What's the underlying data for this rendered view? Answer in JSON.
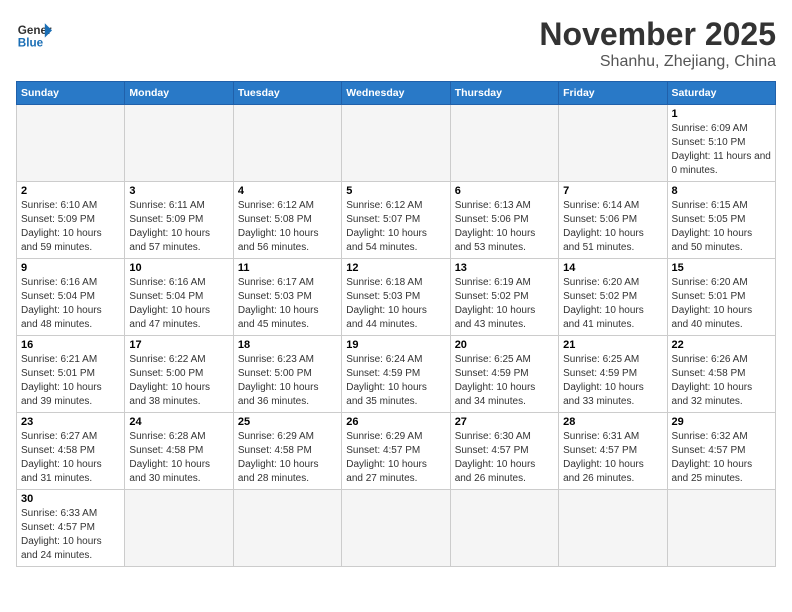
{
  "header": {
    "logo_general": "General",
    "logo_blue": "Blue",
    "title": "November 2025",
    "subtitle": "Shanhu, Zhejiang, China"
  },
  "weekdays": [
    "Sunday",
    "Monday",
    "Tuesday",
    "Wednesday",
    "Thursday",
    "Friday",
    "Saturday"
  ],
  "weeks": [
    [
      {
        "day": "",
        "info": ""
      },
      {
        "day": "",
        "info": ""
      },
      {
        "day": "",
        "info": ""
      },
      {
        "day": "",
        "info": ""
      },
      {
        "day": "",
        "info": ""
      },
      {
        "day": "",
        "info": ""
      },
      {
        "day": "1",
        "info": "Sunrise: 6:09 AM\nSunset: 5:10 PM\nDaylight: 11 hours and 0 minutes."
      }
    ],
    [
      {
        "day": "2",
        "info": "Sunrise: 6:10 AM\nSunset: 5:09 PM\nDaylight: 10 hours and 59 minutes."
      },
      {
        "day": "3",
        "info": "Sunrise: 6:11 AM\nSunset: 5:09 PM\nDaylight: 10 hours and 57 minutes."
      },
      {
        "day": "4",
        "info": "Sunrise: 6:12 AM\nSunset: 5:08 PM\nDaylight: 10 hours and 56 minutes."
      },
      {
        "day": "5",
        "info": "Sunrise: 6:12 AM\nSunset: 5:07 PM\nDaylight: 10 hours and 54 minutes."
      },
      {
        "day": "6",
        "info": "Sunrise: 6:13 AM\nSunset: 5:06 PM\nDaylight: 10 hours and 53 minutes."
      },
      {
        "day": "7",
        "info": "Sunrise: 6:14 AM\nSunset: 5:06 PM\nDaylight: 10 hours and 51 minutes."
      },
      {
        "day": "8",
        "info": "Sunrise: 6:15 AM\nSunset: 5:05 PM\nDaylight: 10 hours and 50 minutes."
      }
    ],
    [
      {
        "day": "9",
        "info": "Sunrise: 6:16 AM\nSunset: 5:04 PM\nDaylight: 10 hours and 48 minutes."
      },
      {
        "day": "10",
        "info": "Sunrise: 6:16 AM\nSunset: 5:04 PM\nDaylight: 10 hours and 47 minutes."
      },
      {
        "day": "11",
        "info": "Sunrise: 6:17 AM\nSunset: 5:03 PM\nDaylight: 10 hours and 45 minutes."
      },
      {
        "day": "12",
        "info": "Sunrise: 6:18 AM\nSunset: 5:03 PM\nDaylight: 10 hours and 44 minutes."
      },
      {
        "day": "13",
        "info": "Sunrise: 6:19 AM\nSunset: 5:02 PM\nDaylight: 10 hours and 43 minutes."
      },
      {
        "day": "14",
        "info": "Sunrise: 6:20 AM\nSunset: 5:02 PM\nDaylight: 10 hours and 41 minutes."
      },
      {
        "day": "15",
        "info": "Sunrise: 6:20 AM\nSunset: 5:01 PM\nDaylight: 10 hours and 40 minutes."
      }
    ],
    [
      {
        "day": "16",
        "info": "Sunrise: 6:21 AM\nSunset: 5:01 PM\nDaylight: 10 hours and 39 minutes."
      },
      {
        "day": "17",
        "info": "Sunrise: 6:22 AM\nSunset: 5:00 PM\nDaylight: 10 hours and 38 minutes."
      },
      {
        "day": "18",
        "info": "Sunrise: 6:23 AM\nSunset: 5:00 PM\nDaylight: 10 hours and 36 minutes."
      },
      {
        "day": "19",
        "info": "Sunrise: 6:24 AM\nSunset: 4:59 PM\nDaylight: 10 hours and 35 minutes."
      },
      {
        "day": "20",
        "info": "Sunrise: 6:25 AM\nSunset: 4:59 PM\nDaylight: 10 hours and 34 minutes."
      },
      {
        "day": "21",
        "info": "Sunrise: 6:25 AM\nSunset: 4:59 PM\nDaylight: 10 hours and 33 minutes."
      },
      {
        "day": "22",
        "info": "Sunrise: 6:26 AM\nSunset: 4:58 PM\nDaylight: 10 hours and 32 minutes."
      }
    ],
    [
      {
        "day": "23",
        "info": "Sunrise: 6:27 AM\nSunset: 4:58 PM\nDaylight: 10 hours and 31 minutes."
      },
      {
        "day": "24",
        "info": "Sunrise: 6:28 AM\nSunset: 4:58 PM\nDaylight: 10 hours and 30 minutes."
      },
      {
        "day": "25",
        "info": "Sunrise: 6:29 AM\nSunset: 4:58 PM\nDaylight: 10 hours and 28 minutes."
      },
      {
        "day": "26",
        "info": "Sunrise: 6:29 AM\nSunset: 4:57 PM\nDaylight: 10 hours and 27 minutes."
      },
      {
        "day": "27",
        "info": "Sunrise: 6:30 AM\nSunset: 4:57 PM\nDaylight: 10 hours and 26 minutes."
      },
      {
        "day": "28",
        "info": "Sunrise: 6:31 AM\nSunset: 4:57 PM\nDaylight: 10 hours and 26 minutes."
      },
      {
        "day": "29",
        "info": "Sunrise: 6:32 AM\nSunset: 4:57 PM\nDaylight: 10 hours and 25 minutes."
      }
    ],
    [
      {
        "day": "30",
        "info": "Sunrise: 6:33 AM\nSunset: 4:57 PM\nDaylight: 10 hours and 24 minutes."
      },
      {
        "day": "",
        "info": ""
      },
      {
        "day": "",
        "info": ""
      },
      {
        "day": "",
        "info": ""
      },
      {
        "day": "",
        "info": ""
      },
      {
        "day": "",
        "info": ""
      },
      {
        "day": "",
        "info": ""
      }
    ]
  ]
}
